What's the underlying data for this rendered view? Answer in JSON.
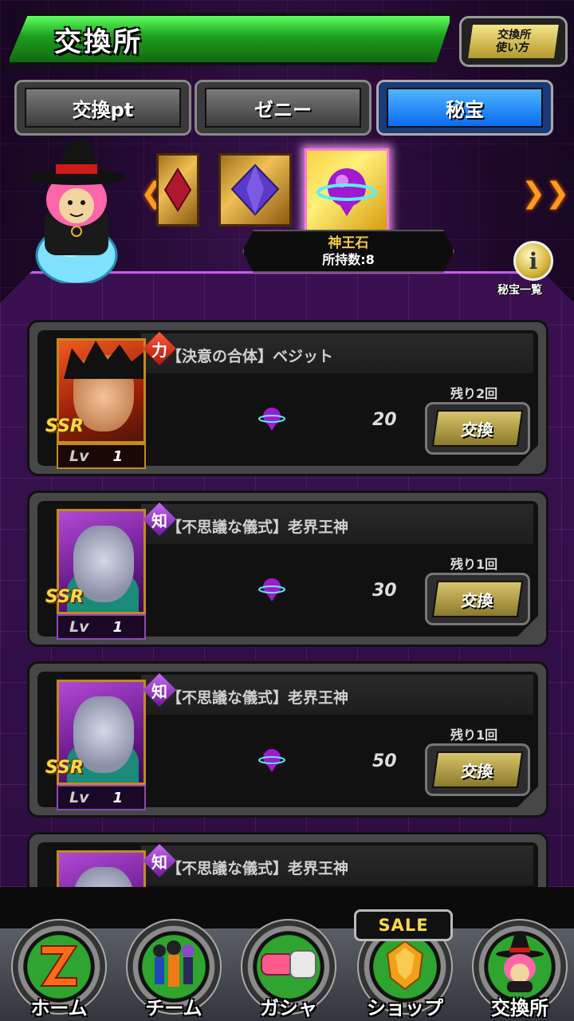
{
  "header": {
    "title": "交換所",
    "howto_line1": "交換所",
    "howto_line2": "使い方"
  },
  "tabs": [
    {
      "label": "交換pt",
      "active": false
    },
    {
      "label": "ゼニー",
      "active": false
    },
    {
      "label": "秘宝",
      "active": true
    }
  ],
  "carousel": {
    "left_arrow": "❮❮",
    "right_arrow": "❯❯",
    "items": [
      "red-crystal-icon",
      "purple-octahedron-icon",
      "kaioshin-stone-icon"
    ],
    "selected": {
      "name": "神王石",
      "owned": "所持数:8"
    }
  },
  "treasure_list_label": "秘宝一覧",
  "info_glyph": "i",
  "cards": [
    {
      "type": "力",
      "type_class": "str",
      "title": "【決意の合体】ベジット",
      "rarity": "SSR",
      "lv_label": "Lv",
      "lv": "1",
      "cost": "20",
      "remaining": "残り2回",
      "button": "交換"
    },
    {
      "type": "知",
      "type_class": "int",
      "title": "【不思議な儀式】老界王神",
      "rarity": "SSR",
      "lv_label": "Lv",
      "lv": "1",
      "cost": "30",
      "remaining": "残り1回",
      "button": "交換"
    },
    {
      "type": "知",
      "type_class": "int",
      "title": "【不思議な儀式】老界王神",
      "rarity": "SSR",
      "lv_label": "Lv",
      "lv": "1",
      "cost": "50",
      "remaining": "残り1回",
      "button": "交換"
    },
    {
      "type": "知",
      "type_class": "int",
      "title": "【不思議な儀式】老界王神",
      "rarity": "",
      "lv_label": "",
      "lv": "",
      "cost": "",
      "remaining": "",
      "button": ""
    }
  ],
  "nav": [
    {
      "label": "ホーム",
      "icon": "z-logo-icon"
    },
    {
      "label": "チーム",
      "icon": "team-icon"
    },
    {
      "label": "ガシャ",
      "icon": "gasha-capsule-icon"
    },
    {
      "label": "ショップ",
      "icon": "dragon-stone-icon"
    },
    {
      "label": "交換所",
      "icon": "babidi-icon"
    }
  ],
  "sale_badge": "SALE",
  "colors": {
    "title_green": "#1f9d1f",
    "tab_active": "#0a6cf0",
    "accent_gold": "#f5c64a",
    "panel_purple": "#3a1150"
  }
}
